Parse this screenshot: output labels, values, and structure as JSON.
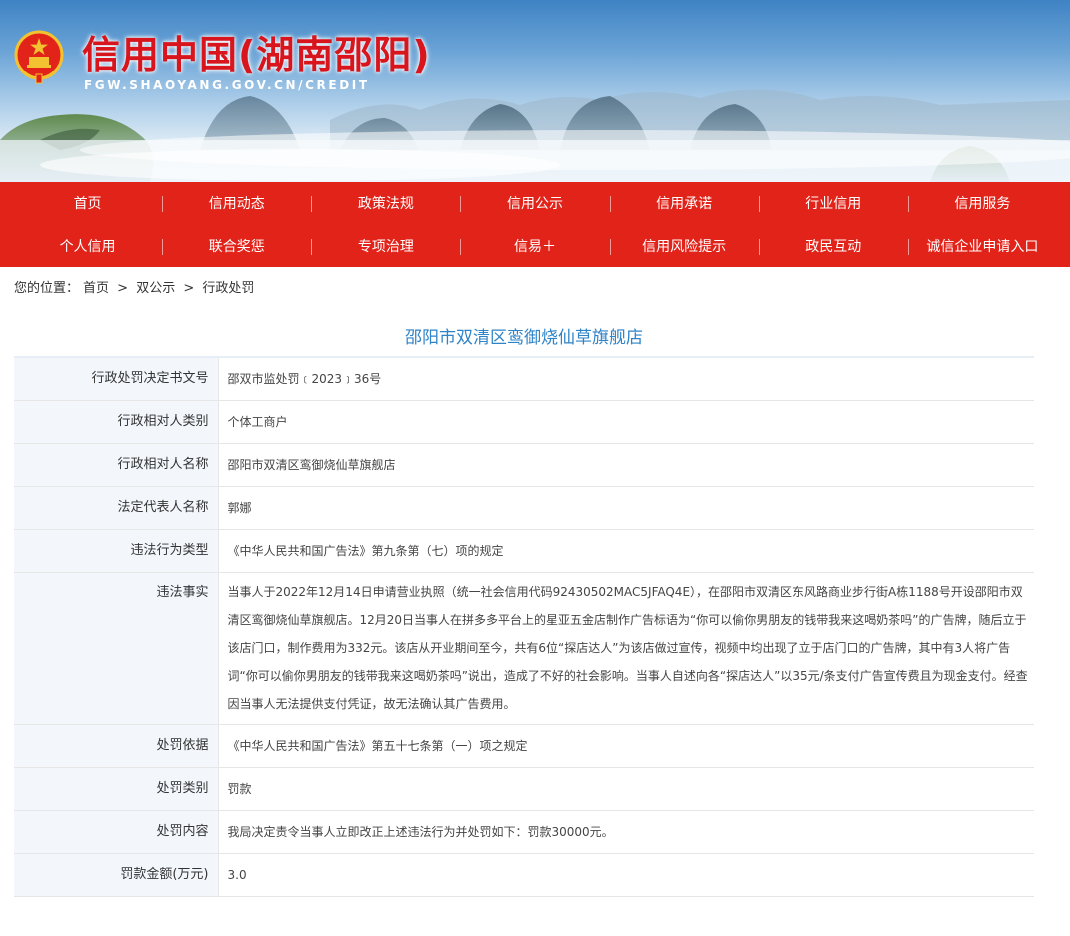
{
  "header": {
    "title": "信用中国(湖南邵阳)",
    "url": "FGW.SHAOYANG.GOV.CN/CREDIT"
  },
  "nav": {
    "row1": [
      "首页",
      "信用动态",
      "政策法规",
      "信用公示",
      "信用承诺",
      "行业信用",
      "信用服务"
    ],
    "row2": [
      "个人信用",
      "联合奖惩",
      "专项治理",
      "信易＋",
      "信用风险提示",
      "政民互动",
      "诚信企业申请入口"
    ]
  },
  "breadcrumb": {
    "prefix": "您的位置：",
    "items": [
      "首页",
      "双公示",
      "行政处罚"
    ],
    "separator": ">"
  },
  "record": {
    "title": "邵阳市双清区鸾御烧仙草旗舰店",
    "fields": [
      {
        "label": "行政处罚决定书文号",
        "value": "邵双市监处罚﹝2023﹞36号"
      },
      {
        "label": "行政相对人类别",
        "value": "个体工商户"
      },
      {
        "label": "行政相对人名称",
        "value": "邵阳市双清区鸾御烧仙草旗舰店"
      },
      {
        "label": "法定代表人名称",
        "value": "郭娜"
      },
      {
        "label": "违法行为类型",
        "value": "《中华人民共和国广告法》第九条第（七）项的规定"
      },
      {
        "label": "违法事实",
        "value": "当事人于2022年12月14日申请营业执照（统一社会信用代码92430502MAC5JFAQ4E），在邵阳市双清区东风路商业步行街A栋1188号开设邵阳市双清区鸾御烧仙草旗舰店。12月20日当事人在拼多多平台上的星亚五金店制作广告标语为“你可以偷你男朋友的钱带我来这喝奶茶吗”的广告牌，随后立于该店门口，制作费用为332元。该店从开业期间至今，共有6位“探店达人”为该店做过宣传，视频中均出现了立于店门口的广告牌，其中有3人将广告词“你可以偷你男朋友的钱带我来这喝奶茶吗”说出，造成了不好的社会影响。当事人自述向各“探店达人”以35元/条支付广告宣传费且为现金支付。经查因当事人无法提供支付凭证，故无法确认其广告费用。"
      },
      {
        "label": "处罚依据",
        "value": "《中华人民共和国广告法》第五十七条第（一）项之规定"
      },
      {
        "label": "处罚类别",
        "value": "罚款"
      },
      {
        "label": "处罚内容",
        "value": "我局决定责令当事人立即改正上述违法行为并处罚如下：罚款30000元。"
      },
      {
        "label": "罚款金额(万元)",
        "value": "3.0"
      }
    ]
  },
  "colors": {
    "nav_bg": "#e2231a",
    "title_red": "#d8141c",
    "record_title_blue": "#2f83c7",
    "label_bg": "#f3f7fc"
  },
  "icons": {
    "emblem": "national-emblem-icon"
  }
}
